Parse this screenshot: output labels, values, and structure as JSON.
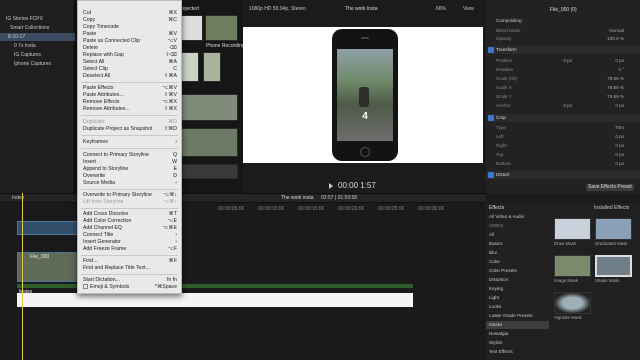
{
  "library": {
    "title": "IG Stories FCPX",
    "items": [
      "Smart Collections",
      "8-10-17",
      "0 7x Insta",
      "IG Captures",
      "Iphone Captures"
    ]
  },
  "browser": {
    "filter": "Rejected",
    "clip_label": "Phone Recording"
  },
  "viewer": {
    "format": "1080p HD 59.94p, Stereo",
    "title": "The work insta",
    "zoom": "66%",
    "view": "View",
    "timecode": "00:00 1:57",
    "overlay_big": "4"
  },
  "inspector": {
    "file": "File_000 (0)",
    "compositing": "Compositing",
    "blend_mode": "Blend Mode",
    "blend_value": "Normal",
    "opacity": "Opacity",
    "opacity_value": "100.0 %",
    "transform": "Transform",
    "position": "Position",
    "position_x": "0 px",
    "position_y": "0 px",
    "rotation": "Rotation",
    "rotation_value": "0 °",
    "scale_all": "Scale (All)",
    "scale_all_value": "79.89 %",
    "scale_x": "Scale X",
    "scale_x_value": "79.89 %",
    "scale_y": "Scale Y",
    "scale_y_value": "79.89 %",
    "anchor": "Anchor",
    "anchor_x": "0 px",
    "anchor_y": "0 px",
    "crop": "Crop",
    "type": "Type",
    "type_value": "Trim",
    "left": "Left",
    "right": "Right",
    "top": "Top",
    "bottom": "Bottom",
    "zero_px": "0 px",
    "distort": "Distort",
    "save_preset": "Save Effects Preset"
  },
  "timeline": {
    "index": "Index",
    "name": "The work insta",
    "duration": "03:57 | 01:59:58",
    "ticks": [
      "00:00:05:00",
      "00:00:10:00",
      "00:00:15:00",
      "00:00:20:00",
      "00:00:25:00",
      "00:00:30:00"
    ],
    "clip_name": "File_000",
    "audio_name": "Meiso"
  },
  "effects": {
    "header": "Effects",
    "installed": "Installed Effects",
    "categories": [
      "All Video & Audio",
      "VIDEO",
      "All",
      "Basics",
      "Blur",
      "Color",
      "Color Presets",
      "Distortion",
      "Keying",
      "Light",
      "Looks",
      "Luster Grade Presets",
      "Masks",
      "Nostalgia",
      "Stylize",
      "Text Effects"
    ],
    "thumbs": [
      "Draw Mask",
      "Graduated Mask",
      "Image Mask",
      "Shape Mask",
      "Vignette Mask"
    ]
  },
  "menu": {
    "items": [
      {
        "label": "Cut",
        "sc": "⌘X"
      },
      {
        "label": "Copy",
        "sc": "⌘C"
      },
      {
        "label": "Copy Timecode",
        "sc": ""
      },
      {
        "label": "Paste",
        "sc": "⌘V"
      },
      {
        "label": "Paste as Connected Clip",
        "sc": "⌥V"
      },
      {
        "label": "Delete",
        "sc": "⌫"
      },
      {
        "label": "Replace with Gap",
        "sc": "⇧⌫"
      },
      {
        "label": "Select All",
        "sc": "⌘A"
      },
      {
        "label": "Select Clip",
        "sc": "C"
      },
      {
        "label": "Deselect All",
        "sc": "⇧⌘A"
      },
      {
        "label": "Paste Effects",
        "sc": "⌥⌘V"
      },
      {
        "label": "Paste Attributes...",
        "sc": "⇧⌘V"
      },
      {
        "label": "Remove Effects",
        "sc": "⌥⌘X"
      },
      {
        "label": "Remove Attributes...",
        "sc": "⇧⌘X"
      },
      {
        "label": "Duplicate",
        "sc": "⌘D"
      },
      {
        "label": "Duplicate Project as Snapshot",
        "sc": "⇧⌘D"
      },
      {
        "label": "Keyframes",
        "sc": "›"
      },
      {
        "label": "Connect to Primary Storyline",
        "sc": "Q"
      },
      {
        "label": "Insert",
        "sc": "W"
      },
      {
        "label": "Append to Storyline",
        "sc": "E"
      },
      {
        "label": "Overwrite",
        "sc": "D"
      },
      {
        "label": "Source Media",
        "sc": "›"
      },
      {
        "label": "Overwrite to Primary Storyline",
        "sc": "⌥⌘↓"
      },
      {
        "label": "Lift from Storyline",
        "sc": "⌥⌘↑"
      },
      {
        "label": "Add Cross Dissolve",
        "sc": "⌘T"
      },
      {
        "label": "Add Color Correction",
        "sc": "⌥E"
      },
      {
        "label": "Add Channel EQ",
        "sc": "⌥⌘E"
      },
      {
        "label": "Connect Title",
        "sc": "›"
      },
      {
        "label": "Insert Generator",
        "sc": "›"
      },
      {
        "label": "Add Freeze Frame",
        "sc": "⌥F"
      },
      {
        "label": "Find...",
        "sc": "⌘F"
      },
      {
        "label": "Find and Replace Title Text...",
        "sc": ""
      },
      {
        "label": "Start Dictation...",
        "sc": "fn fn"
      },
      {
        "label": "Emoji & Symbols",
        "sc": "^⌘Space"
      }
    ]
  }
}
